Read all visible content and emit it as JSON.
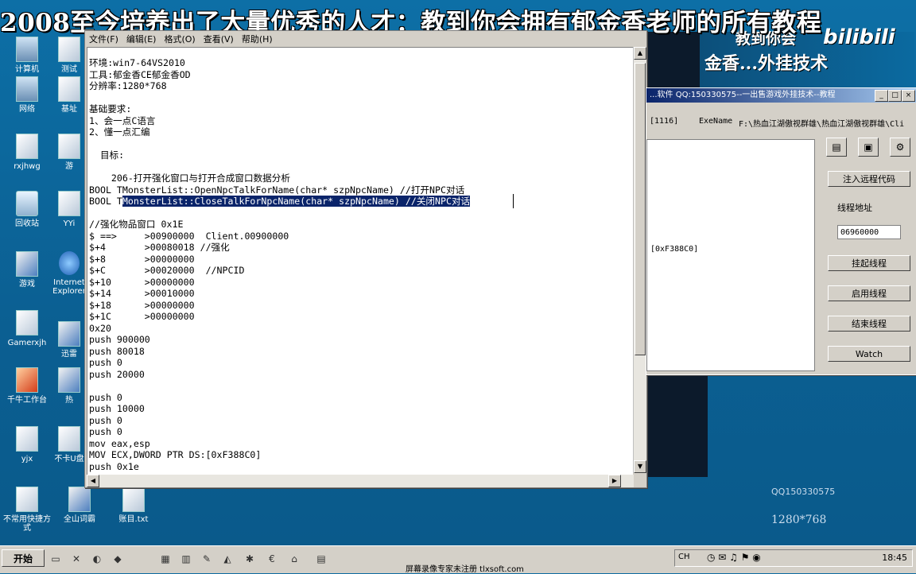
{
  "banner": {
    "text": "2008至今培养出了大量优秀的人才：教到你会拥有郁金香老师的所有教程"
  },
  "brand": {
    "line1": "教到你会",
    "line2": "金香...外挂技术",
    "logo": "bilibili"
  },
  "watermark": {
    "qq": "QQ150330575",
    "resolution": "1280*768"
  },
  "desktop_icons": [
    {
      "label": "计算机",
      "icon": "computer-icon"
    },
    {
      "label": "网络",
      "icon": "network-icon"
    },
    {
      "label": "rxjhwg",
      "icon": "file-icon"
    },
    {
      "label": "回收站",
      "icon": "recycle-bin-icon"
    },
    {
      "label": "游戏",
      "icon": "shortcut-icon"
    },
    {
      "label": "Gamerxjh",
      "icon": "file-icon"
    },
    {
      "label": "千牛工作台",
      "icon": "app-icon"
    },
    {
      "label": "yjx",
      "icon": "file-icon"
    },
    {
      "label": "不常用快捷方式",
      "icon": "file-icon"
    },
    {
      "label": "测试",
      "icon": "file-icon"
    },
    {
      "label": "基址",
      "icon": "file-icon"
    },
    {
      "label": "游",
      "icon": "file-icon"
    },
    {
      "label": "YYi",
      "icon": "file-icon"
    },
    {
      "label": "Internet Explorer",
      "icon": "ie-icon"
    },
    {
      "label": "迅雷",
      "icon": "shortcut-icon"
    },
    {
      "label": "热",
      "icon": "shortcut-icon"
    },
    {
      "label": "不卡U盘",
      "icon": "file-icon"
    },
    {
      "label": "全山词霸",
      "icon": "shortcut-icon"
    },
    {
      "label": "账目.txt",
      "icon": "text-file-icon"
    }
  ],
  "notepad": {
    "menu": [
      "文件(F)",
      "编辑(E)",
      "格式(O)",
      "查看(V)",
      "帮助(H)"
    ],
    "lines_before": "环境:win7-64VS2010\n工具:郁金香CE郁金香OD\n分辨率:1280*768\n\n基础要求:\n1、会一点C语言\n2、懂一点汇编\n\n  目标:\n\n    206-打开强化窗口与打开合成窗口数据分析\nBOOL TMonsterList::OpenNpcTalkForName(char* szpNpcName) //打开NPC对话\nBOOL T",
    "selected": "MonsterList::CloseTalkForNpcName(char* szpNpcName) //关闭NPC对话",
    "lines_after": "\n\n//强化物品窗口 0x1E\n$ ==>     >00900000  Client.00900000\n$+4       >00080018 //强化\n$+8       >00000000\n$+C       >00020000  //NPCID\n$+10      >00000000\n$+14      >00010000\n$+18      >00000000\n$+1C      >00000000\n0x20\npush 900000\npush 80018\npush 0\npush 20000\n\npush 0\npush 10000\npush 0\npush 0\nmov eax,esp\nMOV ECX,DWORD PTR DS:[0xF388C0]\npush 0x1e"
  },
  "tool": {
    "title": "...软件 QQ:150330575--一出售游戏外挂技术--教程",
    "pid": "[1116]",
    "exe_label": "ExeName",
    "exe_path": "F:\\热血江湖傲视群雄\\热血江湖傲视群雄\\Cli",
    "list_item": "[0xF388C0]",
    "buttons": {
      "inject": "注入远程代码",
      "suspend": "挂起线程",
      "resume": "启用线程",
      "terminate": "结束线程",
      "watch": "Watch"
    },
    "thread_label": "线程地址",
    "thread_value": "06960000"
  },
  "taskbar": {
    "start": "开始",
    "clock": "18:45",
    "ime": "CH",
    "footer": "屏幕录像专家未注册 tlxsoft.com"
  }
}
